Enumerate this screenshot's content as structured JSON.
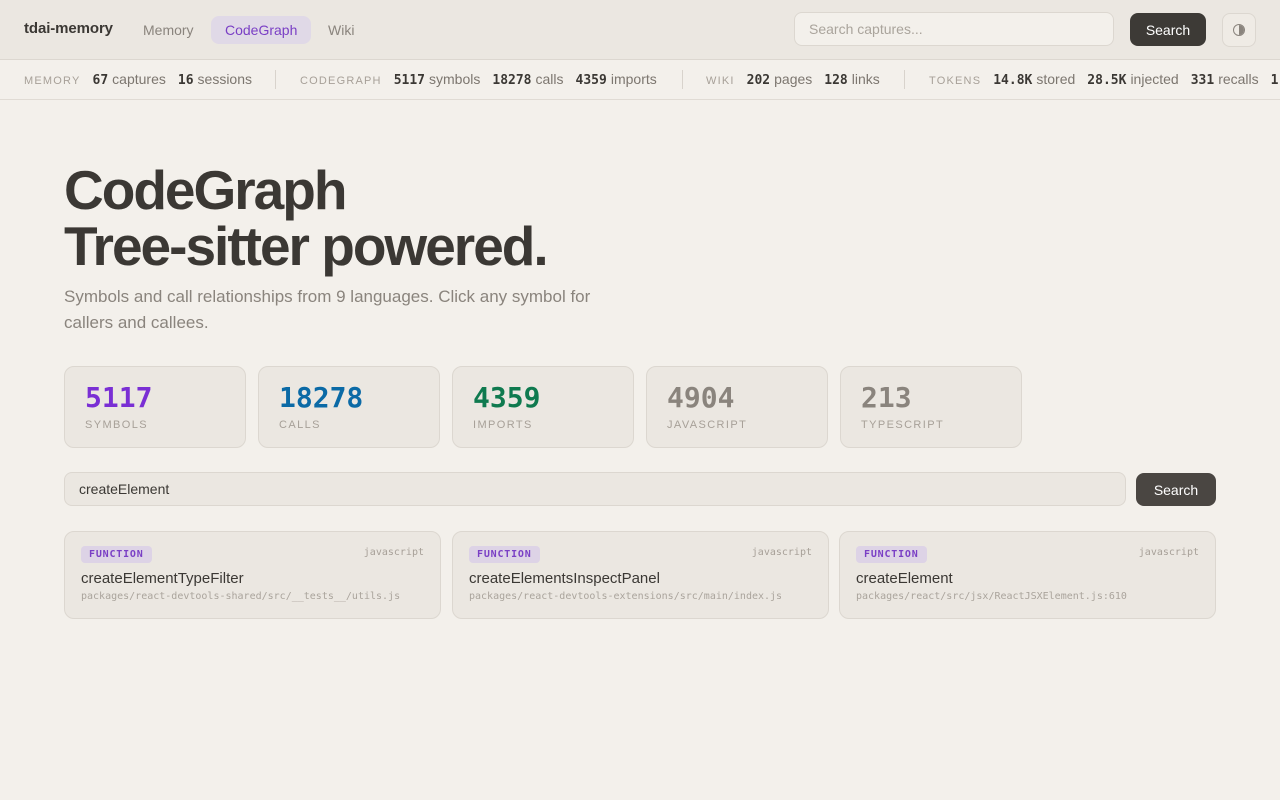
{
  "app": {
    "brand": "tdai-memory",
    "nav": [
      {
        "label": "Memory",
        "active": false
      },
      {
        "label": "CodeGraph",
        "active": true
      },
      {
        "label": "Wiki",
        "active": false
      }
    ],
    "search_placeholder": "Search captures...",
    "search_button": "Search",
    "theme_icon": "contrast-icon"
  },
  "stats": {
    "memory": {
      "label": "MEMORY",
      "items": [
        {
          "value": "67",
          "unit": "captures"
        },
        {
          "value": "16",
          "unit": "sessions"
        }
      ]
    },
    "codegraph": {
      "label": "CODEGRAPH",
      "items": [
        {
          "value": "5117",
          "unit": "symbols"
        },
        {
          "value": "18278",
          "unit": "calls"
        },
        {
          "value": "4359",
          "unit": "imports"
        }
      ]
    },
    "wiki": {
      "label": "WIKI",
      "items": [
        {
          "value": "202",
          "unit": "pages"
        },
        {
          "value": "128",
          "unit": "links"
        }
      ]
    },
    "tokens": {
      "label": "TOKENS",
      "items": [
        {
          "value": "14.8K",
          "unit": "stored"
        },
        {
          "value": "28.5K",
          "unit": "injected"
        },
        {
          "value": "331",
          "unit": "recalls"
        },
        {
          "value": "1",
          "unit": ""
        }
      ]
    }
  },
  "hero": {
    "title_line1": "CodeGraph",
    "title_line2": "Tree-sitter powered.",
    "subtitle": "Symbols and call relationships from 9 languages. Click any symbol for callers and callees."
  },
  "metrics": [
    {
      "value": "5117",
      "label": "SYMBOLS",
      "color": "#7a2fd4"
    },
    {
      "value": "18278",
      "label": "CALLS",
      "color": "#0b6aa6"
    },
    {
      "value": "4359",
      "label": "IMPORTS",
      "color": "#0f7a4f"
    },
    {
      "value": "4904",
      "label": "JAVASCRIPT",
      "color": "#8a847d"
    },
    {
      "value": "213",
      "label": "TYPESCRIPT",
      "color": "#8a847d"
    }
  ],
  "symbol_search": {
    "value": "createElement",
    "button": "Search"
  },
  "results": [
    {
      "kind": "FUNCTION",
      "lang": "javascript",
      "name": "createElementTypeFilter",
      "path": "packages/react-devtools-shared/src/__tests__/utils.js"
    },
    {
      "kind": "FUNCTION",
      "lang": "javascript",
      "name": "createElementsInspectPanel",
      "path": "packages/react-devtools-extensions/src/main/index.js"
    },
    {
      "kind": "FUNCTION",
      "lang": "javascript",
      "name": "createElement",
      "path": "packages/react/src/jsx/ReactJSXElement.js:610"
    }
  ]
}
